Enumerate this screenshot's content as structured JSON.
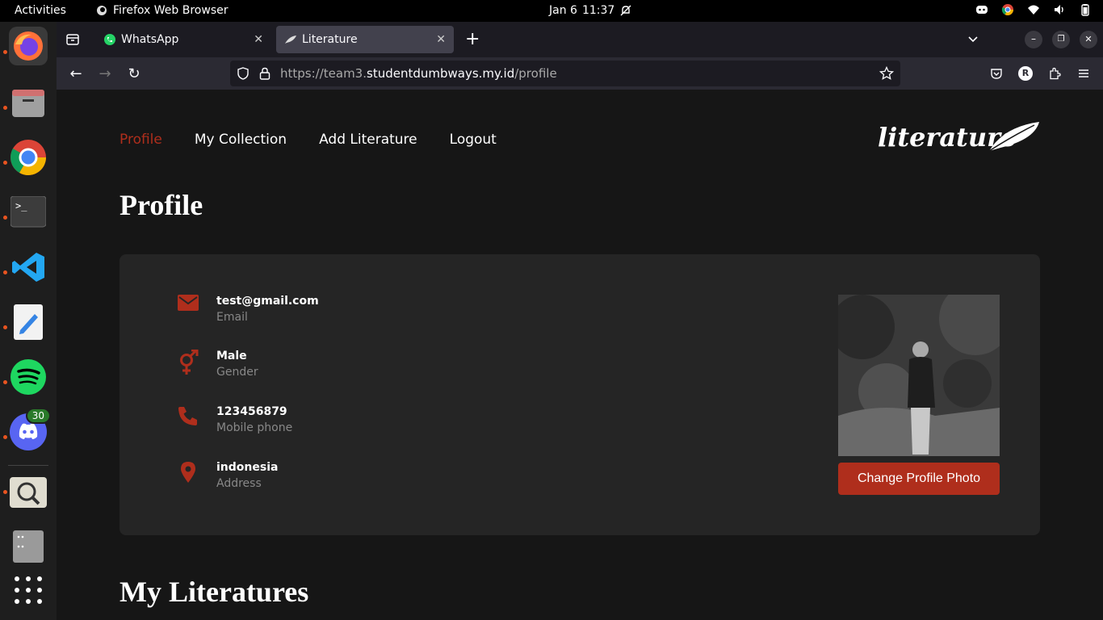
{
  "system": {
    "activities": "Activities",
    "app_name": "Firefox Web Browser",
    "date": "Jan 6",
    "time": "11:37"
  },
  "dock": {
    "discord_badge": "30"
  },
  "browser": {
    "tabs": [
      {
        "label": "WhatsApp"
      },
      {
        "label": "Literature"
      }
    ],
    "url_prefix": "https://team3.",
    "url_host": "studentdumbways.my.id",
    "url_path": "/profile",
    "account_initial": "R"
  },
  "site": {
    "nav": [
      {
        "label": "Profile"
      },
      {
        "label": "My Collection"
      },
      {
        "label": "Add Literature"
      },
      {
        "label": "Logout"
      }
    ],
    "logo": "literature",
    "profile_title": "Profile",
    "profile": {
      "email": "test@gmail.com",
      "email_label": "Email",
      "gender": "Male",
      "gender_label": "Gender",
      "phone": "123456879",
      "phone_label": "Mobile phone",
      "address": "indonesia",
      "address_label": "Address"
    },
    "change_photo_label": "Change Profile Photo",
    "literatures_title": "My Literatures"
  },
  "colors": {
    "accent": "#af2e1c",
    "card": "#252525",
    "background": "#161616"
  }
}
